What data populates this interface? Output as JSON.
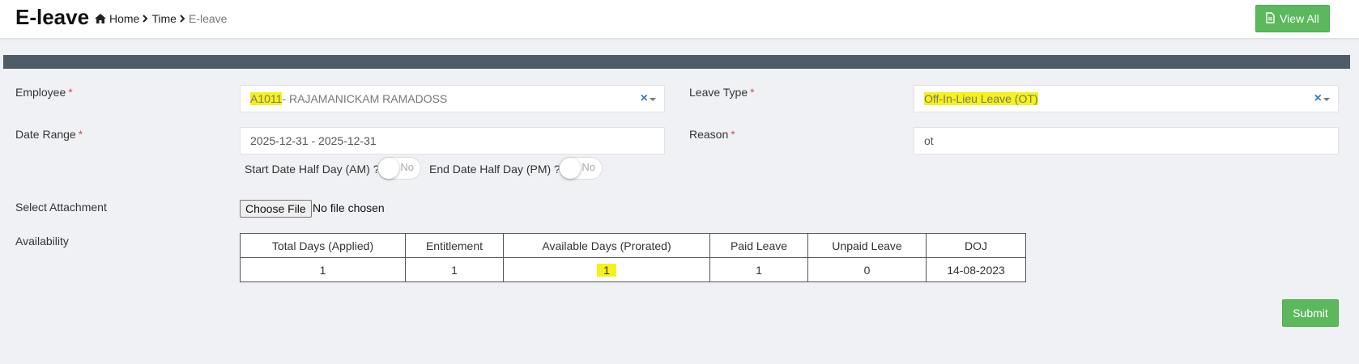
{
  "header": {
    "title": "E-leave",
    "breadcrumb": [
      "Home",
      "Time",
      "E-leave"
    ],
    "view_all_label": "View All",
    "accent_color": "#5cb85c"
  },
  "form": {
    "employee": {
      "label": "Employee",
      "required_mark": "*",
      "code": "A1011",
      "name": " - RAJAMANICKAM RAMADOSS"
    },
    "leave_type": {
      "label": "Leave Type",
      "required_mark": "*",
      "value": "Off-In-Lieu Leave (OT)"
    },
    "date_range": {
      "label": "Date Range",
      "required_mark": "*",
      "value": "2025-12-31 - 2025-12-31"
    },
    "reason": {
      "label": "Reason",
      "required_mark": "*",
      "value": "ot"
    },
    "start_half_day": {
      "label": "Start Date Half Day (AM) ?",
      "state": "No"
    },
    "end_half_day": {
      "label": "End Date Half Day (PM) ?",
      "state": "No"
    },
    "attachment": {
      "label": "Select Attachment",
      "button_label": "Choose File",
      "status": "No file chosen"
    },
    "availability": {
      "label": "Availability",
      "columns": [
        "Total Days (Applied)",
        "Entitlement",
        "Available Days (Prorated)",
        "Paid Leave",
        "Unpaid Leave",
        "DOJ"
      ],
      "row": [
        "1",
        "1",
        "1",
        "1",
        "0",
        "14-08-2023"
      ]
    },
    "submit_label": "Submit"
  }
}
